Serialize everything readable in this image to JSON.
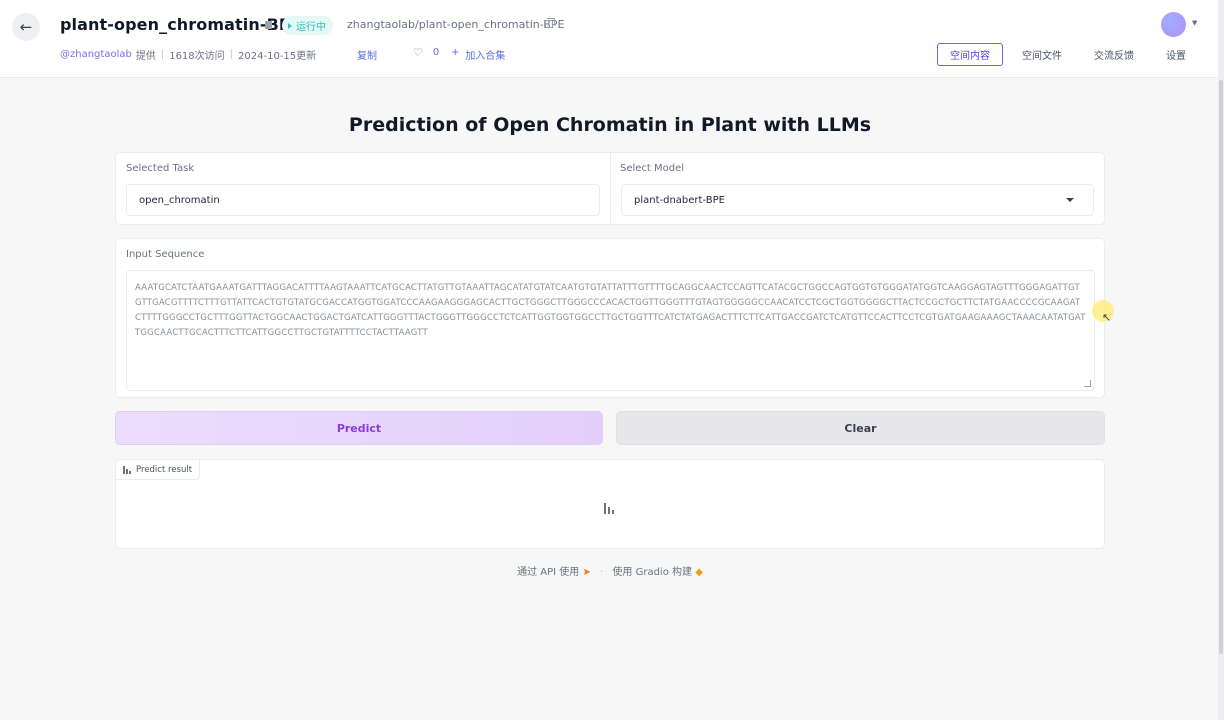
{
  "header": {
    "title": "plant-open_chromatin-BPE",
    "status": "运行中",
    "repo_path": "zhangtaolab/plant-open_chromatin-BPE",
    "author": "@zhangtaolab",
    "provided": "提供",
    "visits": "1618次访问",
    "updated": "2024-10-15更新",
    "copy_label": "复制",
    "likes": "0",
    "add_collection": "加入合集",
    "tabs": [
      "空间内容",
      "空间文件",
      "交流反馈",
      "设置"
    ]
  },
  "main": {
    "title": "Prediction of Open Chromatin in Plant with LLMs",
    "task_label": "Selected Task",
    "task_value": "open_chromatin",
    "model_label": "Select Model",
    "model_value": "plant-dnabert-BPE",
    "sequence_label": "Input Sequence",
    "sequence_value": "AAATGCATCTAATGAAATGATTTAGGACATTTTAAGTAAATTCATGCACTTATGTTGTAAATTAGCATATGTATCAATGTGTATTATTTGTTTTGCAGGCAACTCCAGTTCATACGCTGGCCAGTGGTGTGGGATATGGTCAAGGAGTAGTTTGGGAGATTGTGTTGACGTTTTCTTTGTTATTCACTGTGTATGCGACCATGGTGGATCCCAAGAAGGGAGCACTTGCTGGGCTTGGGCCCACACTGGTTGGGTTTGTAGTGGGGGCCAACATCCTCGCTGGTGGGGCTTACTCCGCTGCTTCTATGAACCCCGCAAGATCTTTTGGGCCTGCTTTGGTTACTGGCAACTGGACTGATCATTGGGTTTACTGGGTTGGGCCTCTCATTGGTGGTGGCCTTGCTGGTTTCATCTATGAGACTTTCTTCATTGACCGATCTCATGTTCCACTTCCTCGTGATGAAGAAAGCTAAACAATATGATTGGCAACTTGCACTTTCTTCATTGGCCTTGCTGTATTTTCCTACTTAAGTT",
    "predict_button": "Predict",
    "clear_button": "Clear",
    "result_label": "Predict result"
  },
  "footer": {
    "api_text": "通过 API 使用",
    "gradio_text": "使用 Gradio 构建"
  },
  "icons": {
    "back": "arrow-left-icon",
    "lock": "lock-icon",
    "copy": "copy-icon",
    "heart": "heart-icon",
    "plus": "plus-icon",
    "chart": "bar-chart-icon",
    "rocket": "rocket-icon",
    "gradio": "gradio-logo-icon"
  },
  "colors": {
    "accent": "#6366f1",
    "status": "#2ec4b6",
    "predict_text": "#8a3ce0"
  }
}
